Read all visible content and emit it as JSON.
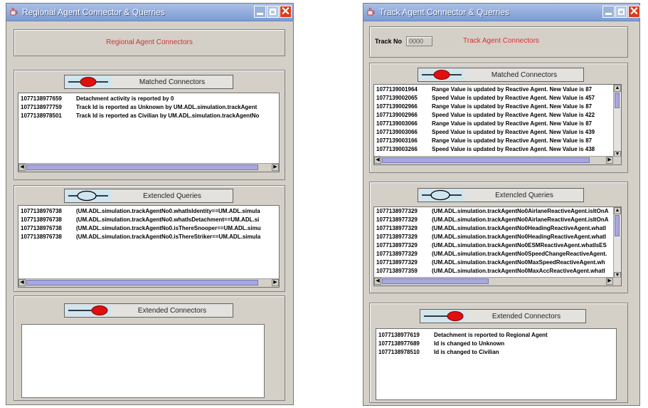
{
  "left_window": {
    "title": "Regional Agent Connector & Querries",
    "header": "Regional Agent Connectors",
    "matched": {
      "label": "Matched Connectors",
      "rows": [
        {
          "ts": "1077138977659",
          "text": "Detachment activity is reported by 0"
        },
        {
          "ts": "1077138977759",
          "text": "Track Id is reported as Unknown by UM.ADL.simulation.trackAgent"
        },
        {
          "ts": "1077138978501",
          "text": "Track Id is reported as Civilian by UM.ADL.simulation.trackAgentNo"
        }
      ]
    },
    "queries": {
      "label": "Extencled Queries",
      "rows": [
        {
          "ts": "1077138976738",
          "text": "(UM.ADL.simulation.trackAgentNo0.whatIsIdentity==UM.ADL.simula"
        },
        {
          "ts": "1077138976738",
          "text": "(UM.ADL.simulation.trackAgentNo0.whatIsDetachment==UM.ADL.si"
        },
        {
          "ts": "1077138976738",
          "text": "(UM.ADL.simulation.trackAgentNo0.isThereSnooper==UM.ADL.simu"
        },
        {
          "ts": "1077138976738",
          "text": "(UM.ADL.simulation.trackAgentNo0.isThereStriker==UM.ADL.simula"
        }
      ]
    },
    "extended": {
      "label": "Extended Connectors",
      "rows": []
    }
  },
  "right_window": {
    "title": "Track Agent Connector & Querries",
    "track_no_label": "Track No",
    "track_no_value": "0000",
    "header": "Track Agent Connectors",
    "matched": {
      "label": "Matched Connectors",
      "rows": [
        {
          "ts": "1077139001964",
          "text": "Range Value is updated by Reactive Agent. New Value is 87"
        },
        {
          "ts": "1077139002065",
          "text": "Speed Value is updated by Reactive Agent. New Value is 457"
        },
        {
          "ts": "1077139002966",
          "text": "Range Value is updated by Reactive Agent. New Value is 87"
        },
        {
          "ts": "1077139002966",
          "text": "Speed Value is updated by Reactive Agent. New Value is 422"
        },
        {
          "ts": "1077139003066",
          "text": "Range Value is updated by Reactive Agent. New Value is 87"
        },
        {
          "ts": "1077139003066",
          "text": "Speed Value is updated by Reactive Agent. New Value is 439"
        },
        {
          "ts": "1077139003166",
          "text": "Range Value is updated by Reactive Agent. New Value is 87"
        },
        {
          "ts": "1077139003266",
          "text": "Speed Value is updated by Reactive Agent. New Value is 438"
        }
      ]
    },
    "queries": {
      "label": "Extencled Queries",
      "rows": [
        {
          "ts": "1077138977329",
          "text": "(UM.ADL.simulation.trackAgentNo0AirlaneReactiveAgent.isItOnA"
        },
        {
          "ts": "1077138977329",
          "text": "(UM.ADL.simulation.trackAgentNo0AirlaneReactiveAgent.isItOnA"
        },
        {
          "ts": "1077138977329",
          "text": "(UM.ADL.simulation.trackAgentNo0HeadingReactiveAgent.whatI"
        },
        {
          "ts": "1077138977329",
          "text": "(UM.ADL.simulation.trackAgentNo0HeadingReactiveAgent.whatI"
        },
        {
          "ts": "1077138977329",
          "text": "(UM.ADL.simulation.trackAgentNo0ESMReactiveAgent.whatIsES"
        },
        {
          "ts": "1077138977329",
          "text": "(UM.ADL.simulation.trackAgentNo0SpeedChangeReactiveAgent."
        },
        {
          "ts": "1077138977329",
          "text": "(UM.ADL.simulation.trackAgentNo0MaxSpeedReactiveAgent.wh"
        },
        {
          "ts": "1077138977359",
          "text": "(UM.ADL.simulation.trackAgentNo0MaxAccReactiveAgent.whatI"
        }
      ]
    },
    "extended": {
      "label": "Extended Connectors",
      "rows": [
        {
          "ts": "1077138977619",
          "text": "Detachment is reported to Regional Agent"
        },
        {
          "ts": "1077138977689",
          "text": "Id is changed to Unknown"
        },
        {
          "ts": "1077138978510",
          "text": "Id is changed to Civilian"
        }
      ]
    }
  },
  "icons": {
    "app": "java-cup-icon",
    "minimize": "minimize-icon",
    "maximize": "maximize-icon",
    "close": "close-icon",
    "matched": "connector-red-node-icon",
    "queries": "connector-hollow-node-icon",
    "extended": "connector-red-end-icon"
  },
  "colors": {
    "title_bar": "#7c9cd3",
    "header_text": "#d83030",
    "scroll_thumb": "#a8a8e0",
    "close_button": "#d93b1e",
    "connector_red": "#e01010"
  }
}
